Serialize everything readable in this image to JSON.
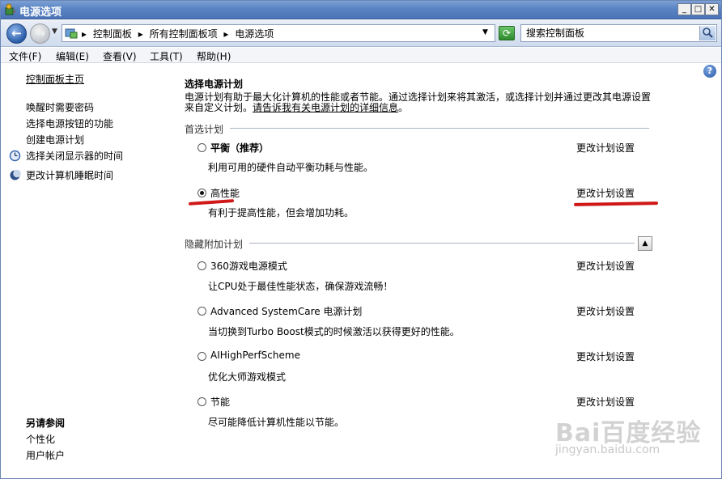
{
  "window": {
    "title": "电源选项",
    "min_glyph": "_",
    "max_glyph": "□",
    "close_glyph": "✕"
  },
  "address": {
    "crumbs": [
      "控制面板",
      "所有控制面板项",
      "电源选项"
    ],
    "separator": "▸",
    "search_placeholder": "搜索控制面板"
  },
  "menu": [
    "文件(F)",
    "编辑(E)",
    "查看(V)",
    "工具(T)",
    "帮助(H)"
  ],
  "left": {
    "home": "控制面板主页",
    "links": [
      "唤醒时需要密码",
      "选择电源按钮的功能",
      "创建电源计划",
      "选择关闭显示器的时间",
      "更改计算机睡眠时间"
    ],
    "see_also_title": "另请参阅",
    "see_also": [
      "个性化",
      "用户帐户"
    ]
  },
  "main": {
    "title": "选择电源计划",
    "desc": "电源计划有助于最大化计算机的性能或者节能。通过选择计划来将其激活，或选择计划并通过更改其电源设置来自定义计划。",
    "desc_link": "请告诉我有关电源计划的详细信息",
    "desc_end": "。",
    "preferred_label": "首选计划",
    "hidden_label": "隐藏附加计划",
    "change_link": "更改计划设置",
    "preferred_plans": [
      {
        "name": "平衡（推荐）",
        "desc": "利用可用的硬件自动平衡功耗与性能。",
        "checked": false
      },
      {
        "name": "高性能",
        "desc": "有利于提高性能，但会增加功耗。",
        "checked": true
      }
    ],
    "hidden_plans": [
      {
        "name": "360游戏电源模式",
        "desc": "让CPU处于最佳性能状态，确保游戏流畅！"
      },
      {
        "name": "Advanced SystemCare 电源计划",
        "desc": "当切换到Turbo Boost模式的时候激活以获得更好的性能。"
      },
      {
        "name": "AIHighPerfScheme",
        "desc": "优化大师游戏模式"
      },
      {
        "name": "节能",
        "desc": "尽可能降低计算机性能以节能。"
      }
    ]
  },
  "watermark": {
    "logo": "Bai百度经验",
    "url": "jingyan.baidu.com"
  },
  "colors": {
    "titlebar": "#5b84c4",
    "highlight_mark": "#d01818"
  }
}
